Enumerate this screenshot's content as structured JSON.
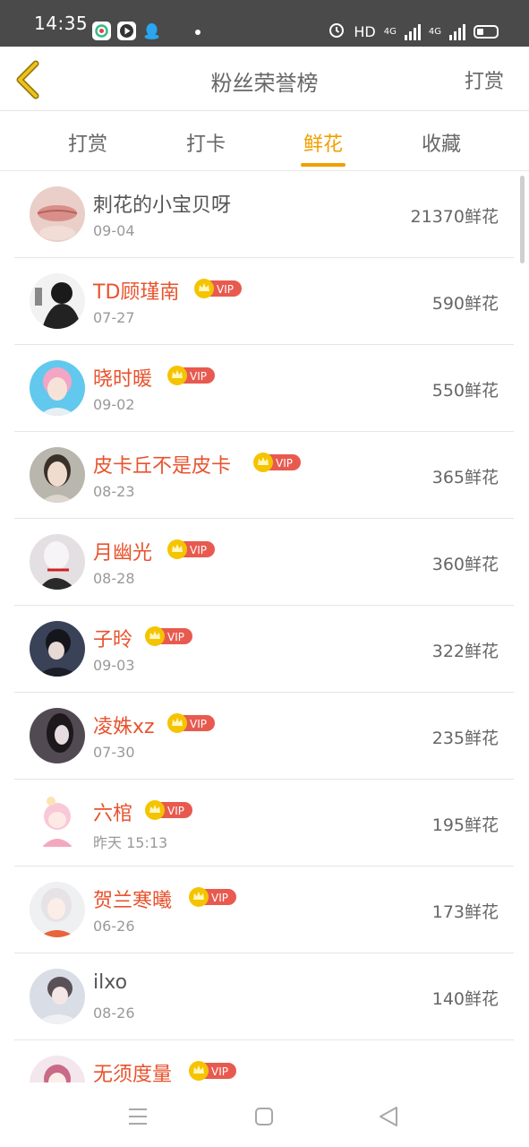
{
  "status_bar": {
    "time": "14:35",
    "network_label": "HD",
    "signal_label_1": "4G",
    "signal_label_2": "4G",
    "icons": [
      "app-icon-1",
      "app-icon-2",
      "qq-icon",
      "alarm-icon",
      "battery-icon"
    ]
  },
  "header": {
    "title": "粉丝荣誉榜",
    "action_label": "打赏",
    "back_icon": "chevron-left-icon"
  },
  "tabs": [
    {
      "label": "打赏",
      "active": false
    },
    {
      "label": "打卡",
      "active": false
    },
    {
      "label": "鲜花",
      "active": true
    },
    {
      "label": "收藏",
      "active": false
    }
  ],
  "vip_label": "VIP",
  "fans": [
    {
      "name": "刺花的小宝贝呀",
      "date": "09-04",
      "count": "21370鲜花",
      "vip": false
    },
    {
      "name": "TD顾瑾南",
      "date": "07-27",
      "count": "590鲜花",
      "vip": true
    },
    {
      "name": "晓时暖",
      "date": "09-02",
      "count": "550鲜花",
      "vip": true
    },
    {
      "name": "皮卡丘不是皮卡",
      "date": "08-23",
      "count": "365鲜花",
      "vip": true
    },
    {
      "name": "月幽光",
      "date": "08-28",
      "count": "360鲜花",
      "vip": true
    },
    {
      "name": "子昤",
      "date": "09-03",
      "count": "322鲜花",
      "vip": true
    },
    {
      "name": "凌姝xz",
      "date": "07-30",
      "count": "235鲜花",
      "vip": true
    },
    {
      "name": "六棺",
      "date": "昨天 15:13",
      "count": "195鲜花",
      "vip": true
    },
    {
      "name": "贺兰寒曦",
      "date": "06-26",
      "count": "173鲜花",
      "vip": true
    },
    {
      "name": "ilxo",
      "date": "08-26",
      "count": "140鲜花",
      "vip": false
    },
    {
      "name": "无须度量",
      "date": "",
      "count": "",
      "vip": true
    }
  ],
  "colors": {
    "accent": "#f0a000",
    "vip_name": "#e8532e",
    "vip_badge": "#e85a4f",
    "crown": "#f5c400"
  },
  "navbar": {
    "icons": [
      "menu-icon",
      "home-square-icon",
      "back-triangle-icon"
    ]
  }
}
